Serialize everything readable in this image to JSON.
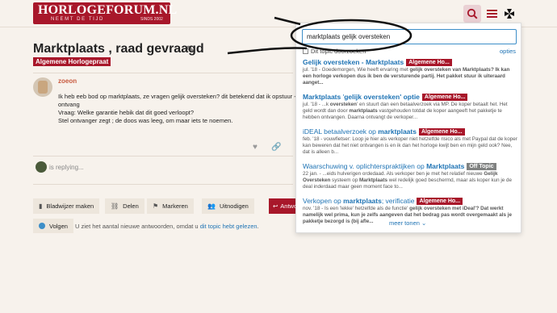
{
  "header": {
    "logo_text": "HORLOGEFORUM.NL",
    "logo_tagline": "NEEMT DE TIJD",
    "logo_since": "SINDS 2002",
    "search_icon": "search-icon",
    "menu_icon": "hamburger-icon",
    "cross_icon": "maltese-cross-icon",
    "accent": "#a8172a"
  },
  "topic": {
    "title": "Marktplaats , raad gevraagd",
    "category": "Algemene Horlogepraat"
  },
  "post": {
    "username": "zoeon",
    "lines": [
      "Ik heb eeb bod op marktplaats, ze vragen gelijk oversteken? dit betekend dat ik opstuur + de",
      "ontvang",
      "Vraag: Welke garantie hebik dat dit goed verloopt?",
      "Stel ontvanger zegt ; de doos was leeg, om maar iets te noemen."
    ]
  },
  "reply_status": "is replying...",
  "controls": {
    "bookmark": "Bladwijzer maken",
    "share": "Delen",
    "flag": "Markeren",
    "invite": "Uitnodigen",
    "reply": "Antwoorden"
  },
  "follow": {
    "button": "Volgen",
    "note_prefix": "U ziet het aantal nieuwe antwoorden, omdat u ",
    "note_link": "dit topic hebt gelezen",
    "note_suffix": "."
  },
  "search": {
    "query": "marktplaats gelijk oversteken",
    "this_topic": "Dit topic doorzoeken",
    "options": "opties",
    "more": "meer tonen",
    "results": [
      {
        "title": "Gelijk oversteken - Marktplaats",
        "badge": "Algemene Ho...",
        "badge_color": "#a8172a",
        "blurb": "jul. '18 - Goedemorgen, Wie heeft ervaring met gelijk oversteken van Marktplaats? Ik kan een horloge verkopen dus ik ben de versturende partij. Het pakket stuur ik uiteraard aanget..."
      },
      {
        "title": "Marktplaats 'gelijk oversteken' optie",
        "badge": "Algemene Ho...",
        "badge_color": "#a8172a",
        "blurb": "jul. '18 - ...k oversteken' en stuurt dan een betaalverzoek via MP. De koper betaalt het. Het geld wordt dan door marktplaats vastgehouden totdat de koper aangeeft het pakketje te hebben ontvangen. Daarna ontvangt de verkoper..."
      },
      {
        "title": "iDEAL betaalverzoek op marktplaats",
        "badge": "Algemene Ho...",
        "badge_color": "#a8172a",
        "blurb": "feb. '18 - vouwfietser: Loop je hier als verkoper niet hetzelfde risico als met Paypal dat de koper kan beweren dat het niet ontvangen is en ik dan het horloge kwijt ben en mijn geld ook? Nee, dat is alleen b..."
      },
      {
        "title": "Waarschuwing v. oplichterspraktijken op Marktplaats",
        "badge": "Off Topic",
        "badge_color": "#808281",
        "blurb": "22 jan. - ...eids hulverigen ordedaad. Als verkoper ben je met het relatief nieuwe Gelijk Oversteken systeem op Marktplaats wel redelijk goed beschermd, maar als koper kun je de deal inderdaad maar geen moment face to..."
      },
      {
        "title": "Verkopen op marktplaats; verificatie",
        "badge": "Algemene Ho...",
        "badge_color": "#a8172a",
        "blurb": "nov. '18 - Is een 'lekke' hetzelfde als de functie' gelijk oversteken met iDeal'? Dat werkt namelijk wel prima, kun je zelfs aangeven dat het bedrag pas wordt overgemaakt als je pakketje bezorgd is (bij afle..."
      }
    ]
  }
}
